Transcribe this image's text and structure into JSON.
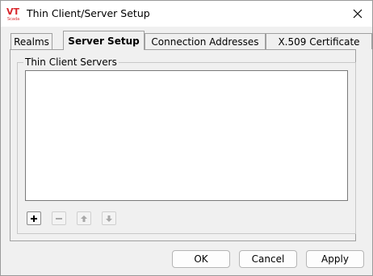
{
  "window": {
    "title": "Thin Client/Server Setup",
    "logo_text": "VT",
    "logo_subtext": "Scada",
    "close_icon": "close-icon"
  },
  "tabs": [
    {
      "label": "Realms",
      "active": false
    },
    {
      "label": "Server Setup",
      "active": true
    },
    {
      "label": "Connection Addresses",
      "active": false
    },
    {
      "label": "X.509 Certificate",
      "active": false
    }
  ],
  "group": {
    "label": "Thin Client Servers"
  },
  "list": {
    "items": []
  },
  "toolbar": {
    "add_icon": "plus-icon",
    "remove_icon": "minus-icon",
    "up_icon": "arrow-up-icon",
    "down_icon": "arrow-down-icon"
  },
  "buttons": {
    "ok": "OK",
    "cancel": "Cancel",
    "apply": "Apply"
  },
  "colors": {
    "logo_red": "#d9262b",
    "disabled_gray": "#a8a8a8"
  }
}
